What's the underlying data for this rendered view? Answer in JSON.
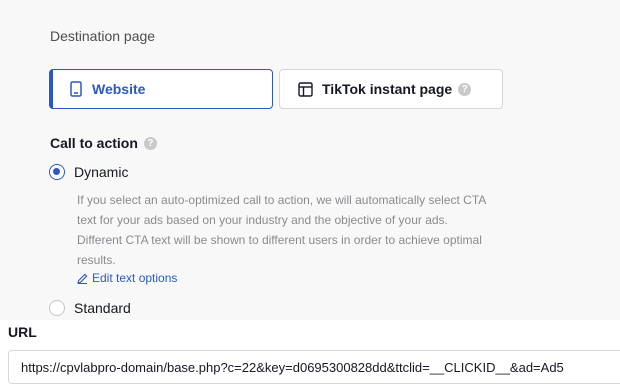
{
  "destination": {
    "label": "Destination page",
    "website_label": "Website",
    "tiktok_label": "TikTok instant page",
    "help_glyph": "?"
  },
  "cta": {
    "title": "Call to action",
    "help_glyph": "?",
    "dynamic_label": "Dynamic",
    "description_lines": [
      "If you select an auto-optimized call to action, we will automatically select CTA",
      "text for your ads based on your industry and the objective of your ads.",
      "Different CTA text will be shown to different users in order to achieve optimal",
      "results."
    ],
    "edit_label": "Edit text options",
    "standard_label": "Standard",
    "selected": "Dynamic"
  },
  "url": {
    "label": "URL",
    "value": "https://cpvlabpro-domain/base.php?c=22&key=d0695300828dd&ttclid=__CLICKID__&ad=Ad5"
  },
  "colors": {
    "accent": "#2b59c3",
    "panel_bg": "#f8f8f8",
    "muted_text": "#8a8b91"
  }
}
